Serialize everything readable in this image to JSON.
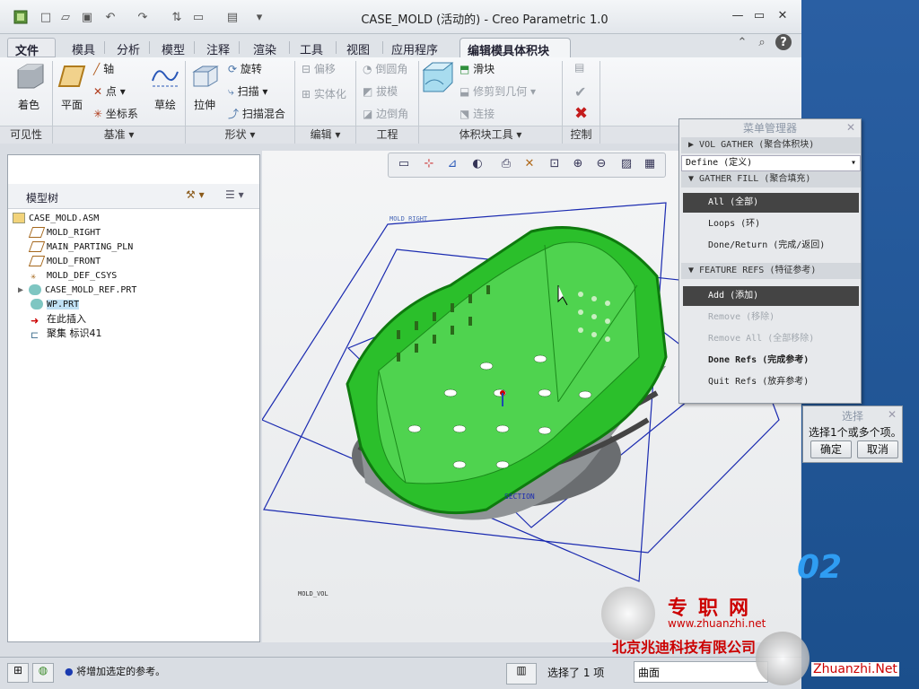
{
  "window": {
    "title": "CASE_MOLD (活动的) - Creo Parametric 1.0"
  },
  "tabs": [
    {
      "label": "文件 ▾"
    },
    {
      "label": "模具"
    },
    {
      "label": "分析"
    },
    {
      "label": "模型"
    },
    {
      "label": "注释"
    },
    {
      "label": "渲染"
    },
    {
      "label": "工具"
    },
    {
      "label": "视图"
    },
    {
      "label": "应用程序"
    },
    {
      "label": "编辑模具体积块"
    }
  ],
  "ribbon": {
    "shade": "着色",
    "plane": "平面",
    "axis": "轴",
    "point": "点",
    "csys": "坐标系",
    "sketch": "草绘",
    "extrude": "拉伸",
    "revolve": "旋转",
    "sweep": "扫描",
    "sweep_blend": "扫描混合",
    "offset": "偏移",
    "solidify": "实体化",
    "round": "倒圆角",
    "draft": "拔模",
    "edge_chamfer": "边倒角",
    "slider": "滑块",
    "trim_to_geom": "修剪到几何",
    "connect": "连接",
    "groups": {
      "visibility": "可见性",
      "datum": "基准 ▾",
      "shapes": "形状 ▾",
      "editing": "编辑 ▾",
      "engineering": "工程",
      "volume_tools": "体积块工具 ▾",
      "control": "控制"
    }
  },
  "tree": {
    "title": "模型树",
    "items": [
      {
        "label": "CASE_MOLD.ASM"
      },
      {
        "label": "MOLD_RIGHT"
      },
      {
        "label": "MAIN_PARTING_PLN"
      },
      {
        "label": "MOLD_FRONT"
      },
      {
        "label": "MOLD_DEF_CSYS"
      },
      {
        "label": "CASE_MOLD_REF.PRT"
      },
      {
        "label": "WP.PRT"
      },
      {
        "label": "在此插入"
      },
      {
        "label": "聚集 标识41"
      }
    ]
  },
  "viewport": {
    "label_right": "MOLD_RIGHT",
    "label_front": "MAIN_PARTING_PLN",
    "label_bottom": "MOLD_VOL",
    "label_section": "SECTION",
    "model_color": "#2bbf2b"
  },
  "menu": {
    "title": "菜单管理器",
    "h1": "VOL GATHER (聚合体积块)",
    "define": "Define (定义)",
    "h2": "GATHER FILL (聚合填充)",
    "all": "All (全部)",
    "loops": "Loops (环)",
    "done_return": "Done/Return (完成/返回)",
    "h3": "FEATURE REFS (特征参考)",
    "add": "Add (添加)",
    "remove": "Remove (移除)",
    "remove_all": "Remove All (全部移除)",
    "done_refs": "Done Refs (完成参考)",
    "quit_refs": "Quit Refs (放弃参考)"
  },
  "select": {
    "title": "选择",
    "prompt": "选择1个或多个项。",
    "ok": "确定",
    "cancel": "取消"
  },
  "status": {
    "message": "将增加选定的参考。",
    "selected": "选择了 1 项",
    "filter": "曲面"
  },
  "watermark": {
    "brand": "专职网",
    "url": "www.zhuanzhi.net",
    "company": "北京兆迪科技有限公司",
    "url2": "Zhuanzhi.Net",
    "version": "02"
  }
}
